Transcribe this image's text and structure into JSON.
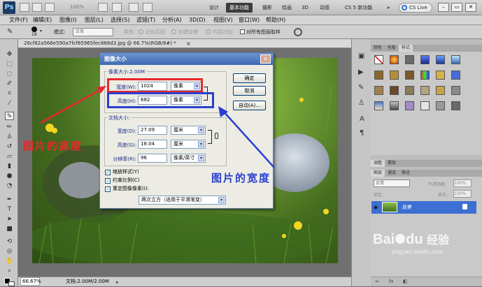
{
  "app": {
    "logo": "Ps",
    "zoom_preset": "100%",
    "workspaces": [
      "设计",
      "基本功能",
      "摄影",
      "绘画",
      "3D",
      "动感",
      "CS 5 新功能"
    ],
    "active_workspace": "基本功能",
    "more": "»",
    "cs_live": "CS Live",
    "window_buttons": [
      "–",
      "▭",
      "✕"
    ]
  },
  "menu": {
    "items": [
      "文件(F)",
      "编辑(E)",
      "图像(I)",
      "图层(L)",
      "选择(S)",
      "滤镜(T)",
      "分析(A)",
      "3D(D)",
      "视图(V)",
      "窗口(W)",
      "帮助(H)"
    ]
  },
  "options": {
    "brush_size": "19",
    "mode_label": "模式:",
    "mode_value": "正常",
    "type_label": "类型:",
    "proximity": "近似匹配",
    "texture": "创建纹理",
    "content_aware": "内容识别",
    "sample_all_layers": "对所有图层取样"
  },
  "document": {
    "tab_title": "26cf82a566e590a7fcf65965fec888d3.jpg @ 66.7%(RGB/8#) *",
    "tab_close": "×",
    "status_zoom": "66.67%",
    "status_doc": "文档:2.00M/2.00M"
  },
  "right_panel": {
    "top_tabs": [
      "颜色",
      "色板",
      "样式"
    ],
    "active_top_tab": "样式",
    "mid_tabs": [
      "调整",
      "蒙版"
    ],
    "layer_tabs": [
      "图层",
      "通道",
      "路径"
    ],
    "blend_mode": "正常",
    "opacity_label": "不透明度:",
    "opacity_value": "100%",
    "lock_label": "锁定:",
    "fill_label": "填充:",
    "fill_value": "100%",
    "layer_name": "背景",
    "bottom_icons": [
      "fx"
    ]
  },
  "dialog": {
    "title": "图像大小",
    "close": "✕",
    "pixel_section": "像素大小:2.00M",
    "width_label": "宽度(W):",
    "width_value": "1024",
    "width_unit": "像素",
    "height_label": "高度(H):",
    "height_value": "682",
    "height_unit": "像素",
    "doc_section": "文档大小:",
    "doc_width_label": "宽度(D):",
    "doc_width_value": "27.09",
    "doc_width_unit": "厘米",
    "doc_height_label": "高度(G):",
    "doc_height_value": "18.04",
    "doc_height_unit": "厘米",
    "resolution_label": "分辨率(R):",
    "resolution_value": "96",
    "resolution_unit": "像素/英寸",
    "ok": "确定",
    "cancel": "取消",
    "auto": "自动(A)...",
    "scale_styles": "缩放样式(Y)",
    "constrain": "约束比例(C)",
    "resample": "重定图像像素(I):",
    "resample_method": "两次立方（适用于平滑渐变）"
  },
  "annotations": {
    "height_note": "图片的高度",
    "width_note": "图片的宽度",
    "red": "#e8282b",
    "blue": "#2a3fd0"
  },
  "watermark": {
    "brand": "Bai",
    "brand2": "du",
    "jingyan": "经验",
    "url": "jingyan.baidu.com"
  }
}
